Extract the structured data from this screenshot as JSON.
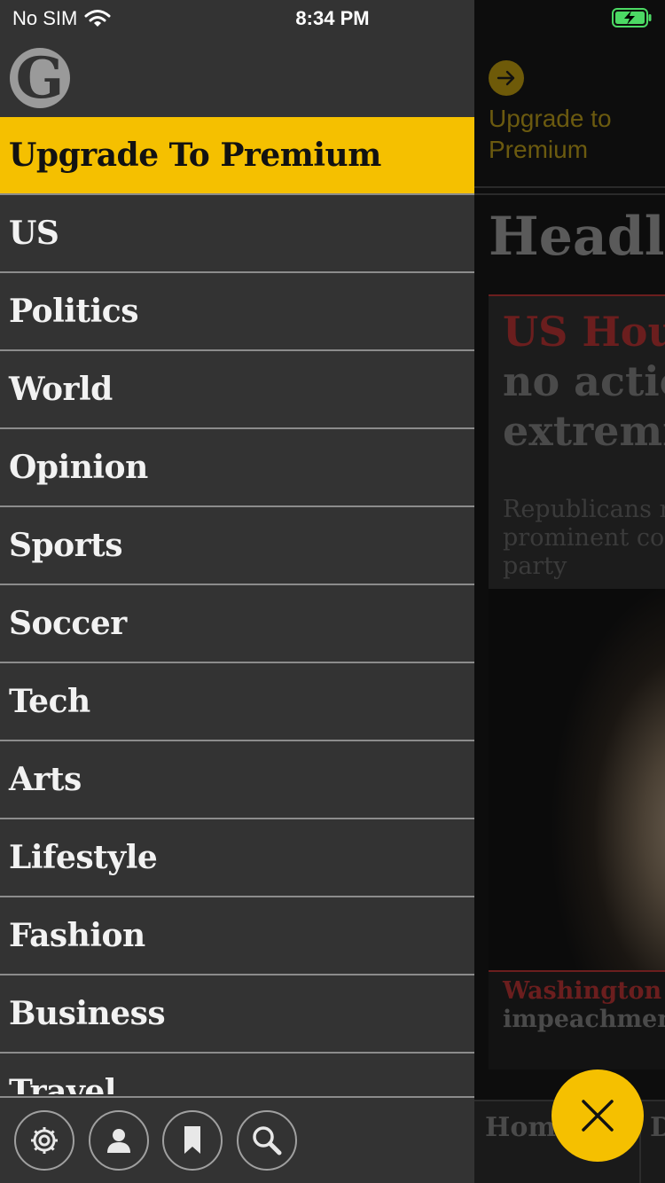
{
  "status_bar": {
    "carrier": "No SIM",
    "time": "8:34 PM",
    "wifi_icon": "wifi-icon",
    "battery_icon": "battery-charging-icon"
  },
  "drawer": {
    "logo_letter": "G",
    "menu_items": [
      {
        "label": "Upgrade To Premium"
      },
      {
        "label": "US"
      },
      {
        "label": "Politics"
      },
      {
        "label": "World"
      },
      {
        "label": "Opinion"
      },
      {
        "label": "Sports"
      },
      {
        "label": "Soccer"
      },
      {
        "label": "Tech"
      },
      {
        "label": "Arts"
      },
      {
        "label": "Lifestyle"
      },
      {
        "label": "Fashion"
      },
      {
        "label": "Business"
      },
      {
        "label": "Travel"
      }
    ],
    "toolbar": [
      "settings-icon",
      "profile-icon",
      "bookmark-icon",
      "search-icon"
    ]
  },
  "background": {
    "upgrade_label": "Upgrade to Premium",
    "section_heading": "Headlines",
    "card1": {
      "kicker": "US House",
      "title_rest": "no action extremism",
      "trail": "Republicans move against prominent conservative in party"
    },
    "card2": {
      "kicker": "Washington / R",
      "text": "impeachment"
    },
    "tabs": [
      "Home",
      "D"
    ]
  },
  "colors": {
    "accent": "#f5c000",
    "drawer_bg": "#333333",
    "divider": "#8c8c8c",
    "kicker_red": "#6b1e1e"
  }
}
